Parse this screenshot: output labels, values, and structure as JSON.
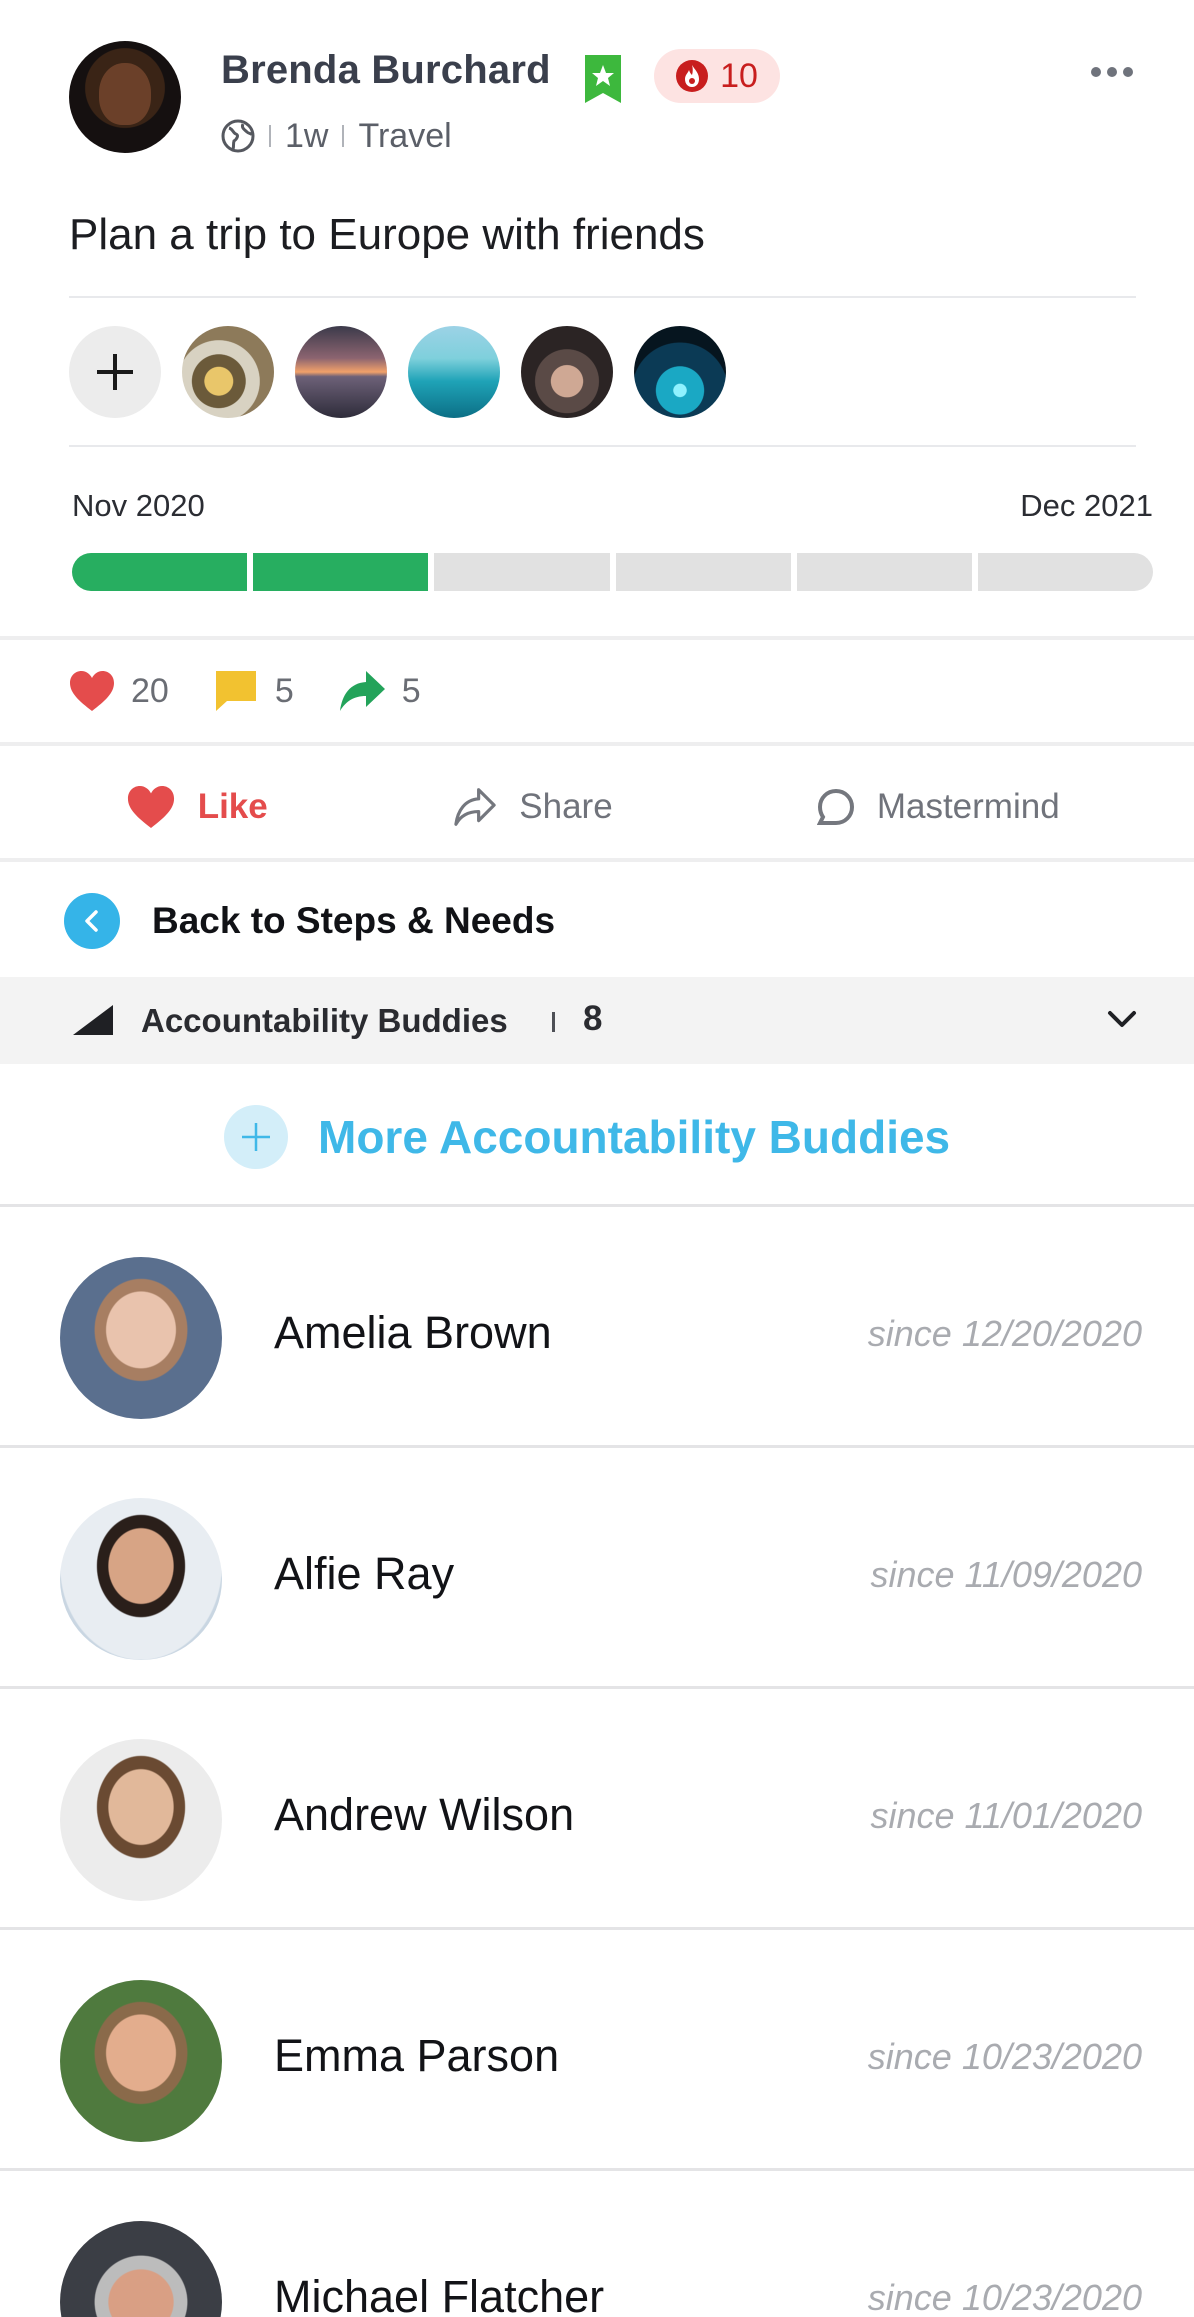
{
  "post": {
    "author": "Brenda Burchard",
    "streak": "10",
    "time": "1w",
    "category": "Travel",
    "title": "Plan a trip to Europe with friends",
    "icons": [
      "globe-icon",
      "verified-star-badge-icon",
      "flame-icon",
      "more-options-icon"
    ]
  },
  "media": {
    "thumbnails": [
      "bottles-thumbnail",
      "sunset-sea-thumbnail",
      "lagoon-swing-thumbnail",
      "friends-car-thumbnail",
      "concert-lights-thumbnail"
    ]
  },
  "timeline": {
    "start": "Nov 2020",
    "end": "Dec 2021",
    "segments_total": 6,
    "segments_done": 2
  },
  "stats": {
    "likes": "20",
    "comments": "5",
    "shares": "5"
  },
  "actions": {
    "like": "Like",
    "share": "Share",
    "mastermind": "Mastermind"
  },
  "nav": {
    "back_label": "Back to Steps & Needs"
  },
  "section": {
    "title": "Accountability Buddies",
    "count": "8",
    "more_label": "More Accountability Buddies"
  },
  "buddies": [
    {
      "name": "Amelia Brown",
      "since": "since 12/20/2020"
    },
    {
      "name": "Alfie Ray",
      "since": "since 11/09/2020"
    },
    {
      "name": "Andrew Wilson",
      "since": "since 11/01/2020"
    },
    {
      "name": "Emma Parson",
      "since": "since 10/23/2020"
    },
    {
      "name": "Michael Flatcher",
      "since": "since 10/23/2020"
    }
  ],
  "colors": {
    "accent_blue": "#3fb8e8",
    "progress_green": "#27ae60",
    "like_red": "#e44c4c",
    "comment_yellow": "#f2c230",
    "share_green": "#23a35a",
    "streak_red": "#c81e1e"
  }
}
